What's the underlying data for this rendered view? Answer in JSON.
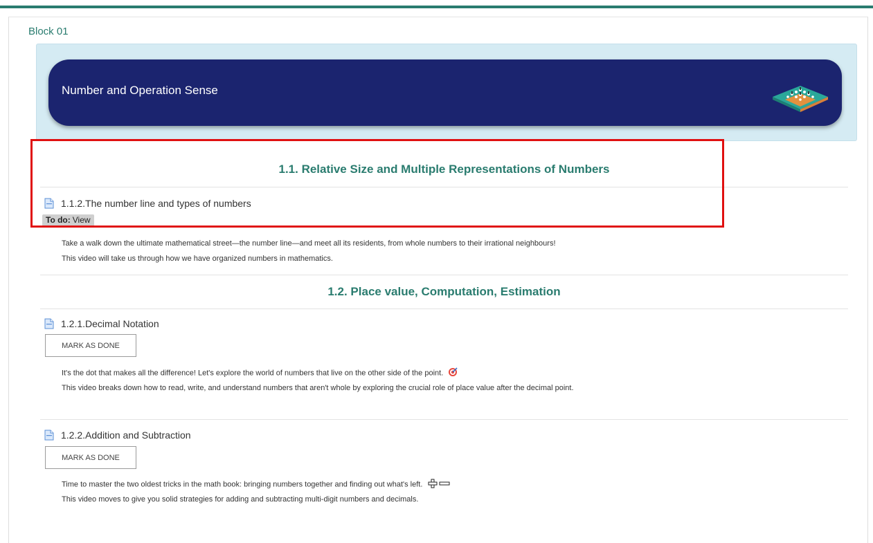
{
  "block": {
    "title": "Block 01"
  },
  "banner": {
    "title": "Number and Operation Sense",
    "logo_icon": "isometric-blocks-icon"
  },
  "sections": [
    {
      "title": "1.1. Relative Size and Multiple Representations of Numbers",
      "activities": [
        {
          "name": "1.1.2.The number line and types of numbers",
          "icon": "page-icon",
          "todo": {
            "label": "To do:",
            "value": "View"
          },
          "description": [
            "Take a walk down the ultimate mathematical street—the number line—and meet all its residents, from whole numbers to their irrational neighbours!",
            "This video will take us through how we have organized numbers in mathematics."
          ]
        }
      ]
    },
    {
      "title": "1.2. Place value, Computation, Estimation",
      "activities": [
        {
          "name": "1.2.1.Decimal Notation",
          "icon": "page-icon",
          "button": "MARK AS DONE",
          "description": [
            "It's the dot that makes all the difference! Let's explore the world of numbers that live on the other side of the point.",
            "This video breaks down how to read, write, and understand numbers that aren't whole by exploring the crucial role of place value after the decimal point."
          ],
          "emoji": "target-icon"
        },
        {
          "name": "1.2.2.Addition and Subtraction",
          "icon": "page-icon",
          "button": "MARK AS DONE",
          "description": [
            "Time to master the two oldest tricks in the math book: bringing numbers together and finding out what's left.",
            "This video moves to give you solid strategies for adding and subtracting multi-digit numbers and decimals."
          ],
          "emoji": "plus-minus-icon"
        }
      ]
    }
  ],
  "colors": {
    "accent": "#2a7c6f",
    "banner": "#1b246f",
    "highlight": "#e01010"
  }
}
